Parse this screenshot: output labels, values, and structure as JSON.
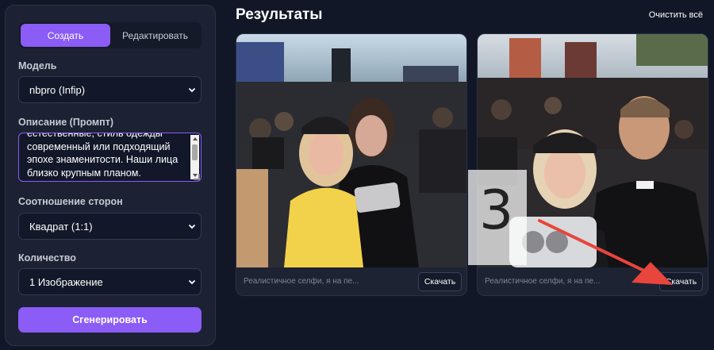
{
  "sidebar": {
    "tabs": [
      {
        "label": "Создать",
        "active": true
      },
      {
        "label": "Редактировать",
        "active": false
      }
    ],
    "model": {
      "label": "Модель",
      "value": "nbpro (Infip)"
    },
    "prompt": {
      "label": "Описание (Промпт)",
      "value": "естественные, стиль одежды современный или подходящий эпохе знаменитости. Наши лица близко крупным планом."
    },
    "aspect": {
      "label": "Соотношение сторон",
      "value": "Квадрат (1:1)"
    },
    "count": {
      "label": "Количество",
      "value": "1 Изображение"
    },
    "generate_label": "Сгенерировать"
  },
  "results": {
    "title": "Результаты",
    "clear_label": "Очистить всё",
    "cards": [
      {
        "caption": "Реалистичное селфи, я на пе...",
        "download_label": "Скачать"
      },
      {
        "caption": "Реалистичное селфи, я на пе...",
        "download_label": "Скачать"
      }
    ]
  },
  "overlay": {
    "step_number": "3",
    "accent": "#e8453c"
  },
  "colors": {
    "accent": "#8b5cf6",
    "background": "#121727",
    "panel": "#1c2233"
  }
}
